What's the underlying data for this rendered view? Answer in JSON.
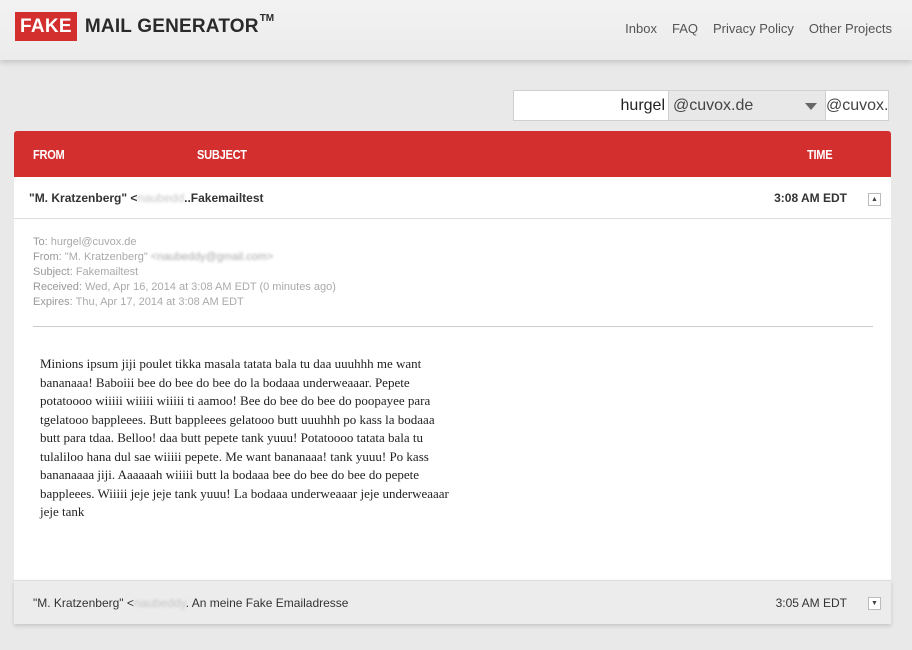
{
  "logo": {
    "fake": "FAKE",
    "rest": "MAIL GENERATOR",
    "tm": "TM"
  },
  "nav": [
    {
      "label": "Inbox"
    },
    {
      "label": "FAQ"
    },
    {
      "label": "Privacy Policy"
    },
    {
      "label": "Other Projects"
    }
  ],
  "address": {
    "username": "hurgel",
    "domain": "@cuvox.de",
    "full_display": "@cuvox.de"
  },
  "table": {
    "col_from": "FROM",
    "col_subject": "SUBJECT",
    "col_time": "TIME"
  },
  "messages": [
    {
      "from_name": "\"M. Kratzenberg\" <",
      "from_blurred": "naubedd",
      "subject_prefix": "..Fakemailtest",
      "time": "3:08 AM EDT",
      "toggle": "▲",
      "meta": {
        "to_label": "To:",
        "to": "hurgel@cuvox.de",
        "from_label": "From:",
        "from_name": "\"M. Kratzenberg\"",
        "from_email": "<naubeddy@gmail.com>",
        "subject_label": "Subject:",
        "subject": "Fakemailtest",
        "received_label": "Received:",
        "received": "Wed, Apr 16, 2014 at 3:08 AM EDT (0 minutes ago)",
        "expires_label": "Expires:",
        "expires": "Thu, Apr 17, 2014 at 3:08 AM EDT"
      },
      "body": "Minions ipsum jiji poulet tikka masala tatata bala tu daa uuuhhh me want bananaaa! Baboiii bee do bee do bee do la bodaaa underweaaar. Pepete potatoooo wiiiii wiiiii wiiiii ti aamoo! Bee do bee do bee do poopayee para tgelatooo bappleees. Butt bappleees gelatooo butt uuuhhh po kass la bodaaa butt para tdaa. Belloo! daa butt pepete tank yuuu! Potatoooo tatata bala tu tulaliloo hana dul sae wiiiii pepete. Me want bananaaa! tank yuuu! Po kass bananaaaa jiji. Aaaaaah wiiiii butt la bodaaa bee do bee do bee do pepete bappleees. Wiiiii jeje jeje tank yuuu! La bodaaa underweaaar jeje underweaaar jeje tank"
    },
    {
      "from_name": "\"M. Kratzenberg\" <",
      "from_blurred": "naubeddy",
      "subject_prefix": ". An meine Fake Emailadresse",
      "time": "3:05 AM EDT",
      "toggle": "▼"
    }
  ],
  "colors": {
    "accent": "#d32f2f"
  }
}
